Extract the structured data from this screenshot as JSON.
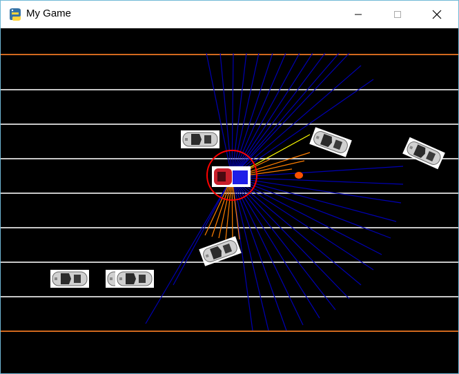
{
  "window": {
    "title": "My Game",
    "icon": "python-icon"
  },
  "controls": {
    "minimize": "minimize-icon",
    "maximize": "maximize-icon",
    "close": "close-icon"
  },
  "colors": {
    "background": "#000000",
    "road_edge": "#d2691e",
    "lane_line": "#c8c8c8",
    "ray_far": "#0000b4",
    "ray_near": "#ff7f00",
    "ray_hit": "#ffff00",
    "sensor_circle": "#ff0000",
    "target": "#ff5000"
  },
  "scene": {
    "lane_count": 8,
    "npc_cars": 6,
    "player_car": "red-car",
    "sensor": "lidar-rays"
  }
}
